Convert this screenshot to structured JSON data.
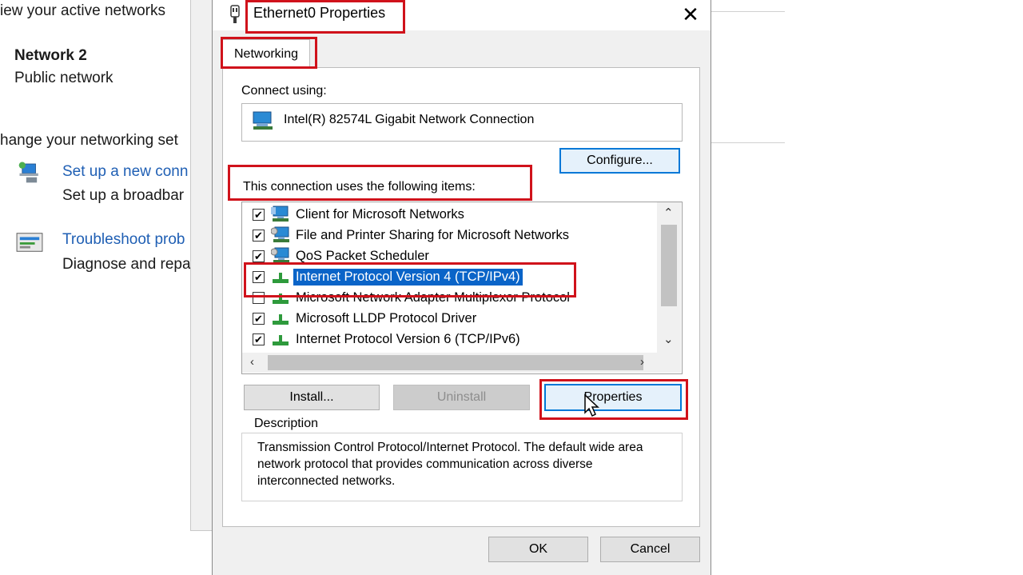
{
  "background": {
    "active_networks_header": "iew your active networks",
    "network_name": "Network 2",
    "network_type": "Public network",
    "change_settings_header": "hange your networking set",
    "setup_link": "Set up a new conn",
    "setup_desc": "Set up a broadbar",
    "troubleshoot_link": "Troubleshoot prob",
    "troubleshoot_desc": "Diagnose and repa"
  },
  "dialog": {
    "title": "Ethernet0 Properties",
    "tab_label": "Networking",
    "connect_using_label": "Connect using:",
    "adapter_name": "Intel(R) 82574L Gigabit Network Connection",
    "configure_button": "Configure...",
    "items_label": "This connection uses the following items:",
    "items": [
      {
        "label": "Client for Microsoft Networks",
        "checked": true,
        "icon": "network-client-icon"
      },
      {
        "label": "File and Printer Sharing for Microsoft Networks",
        "checked": true,
        "icon": "network-service-icon"
      },
      {
        "label": "QoS Packet Scheduler",
        "checked": true,
        "icon": "network-service-icon"
      },
      {
        "label": "Internet Protocol Version 4 (TCP/IPv4)",
        "checked": true,
        "selected": true,
        "icon": "protocol-icon"
      },
      {
        "label": "Microsoft Network Adapter Multiplexor Protocol",
        "checked": false,
        "icon": "protocol-icon"
      },
      {
        "label": "Microsoft LLDP Protocol Driver",
        "checked": true,
        "icon": "protocol-icon"
      },
      {
        "label": "Internet Protocol Version 6 (TCP/IPv6)",
        "checked": true,
        "icon": "protocol-icon"
      }
    ],
    "install_button": "Install...",
    "uninstall_button": "Uninstall",
    "properties_button": "Properties",
    "description_title": "Description",
    "description_text": "Transmission Control Protocol/Internet Protocol. The default wide area network protocol that provides communication across diverse interconnected networks.",
    "ok_button": "OK",
    "cancel_button": "Cancel"
  },
  "colors": {
    "highlight": "#d0121b",
    "selection": "#0a64c8",
    "link": "#1f5fb4"
  }
}
